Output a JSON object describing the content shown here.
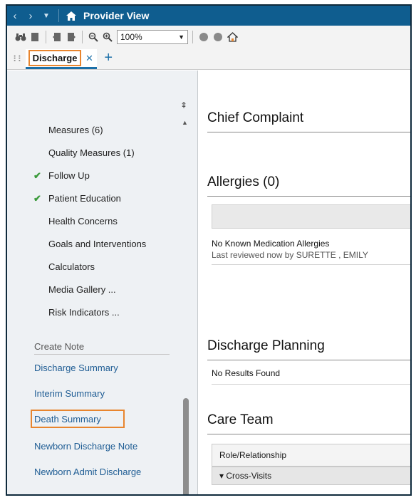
{
  "titlebar": {
    "title": "Provider View",
    "back_icon": "chevron-left",
    "forward_icon": "chevron-right",
    "dropdown_icon": "caret-down",
    "home_icon": "home"
  },
  "toolbar": {
    "zoom_value": "100%"
  },
  "tabs": [
    {
      "label": "Discharge",
      "close": "×"
    }
  ],
  "tab_add": "+",
  "sidebar": {
    "items": [
      {
        "label": "Measures (6)",
        "checked": false
      },
      {
        "label": "Quality Measures (1)",
        "checked": false
      },
      {
        "label": "Follow Up",
        "checked": true
      },
      {
        "label": "Patient Education",
        "checked": true
      },
      {
        "label": "Health Concerns",
        "checked": false
      },
      {
        "label": "Goals and Interventions",
        "checked": false
      },
      {
        "label": "Calculators",
        "checked": false
      },
      {
        "label": "Media Gallery ...",
        "checked": false
      },
      {
        "label": "Risk Indicators ...",
        "checked": false
      }
    ],
    "create_note_label": "Create Note",
    "notes": [
      "Discharge Summary",
      "Interim Summary",
      "Death Summary",
      "Newborn Discharge Note",
      "Newborn Admit Discharge"
    ],
    "check_glyph": "✔",
    "pin_glyph": "⇞",
    "scroll_up_glyph": "▲"
  },
  "content": {
    "chief_complaint_title": "Chief Complaint",
    "allergies_title": "Allergies (0)",
    "allergies_text": "No Known Medication Allergies",
    "allergies_sub": "Last reviewed now by SURETTE , EMILY",
    "discharge_planning_title": "Discharge Planning",
    "discharge_planning_text": "No Results Found",
    "care_team_title": "Care Team",
    "care_team_header": "Role/Relationship",
    "care_team_group": "▾ Cross-Visits"
  },
  "colors": {
    "titlebar": "#0f5d8f",
    "highlight": "#e8852e",
    "link": "#1f5d94",
    "check": "#3a9a3a"
  }
}
